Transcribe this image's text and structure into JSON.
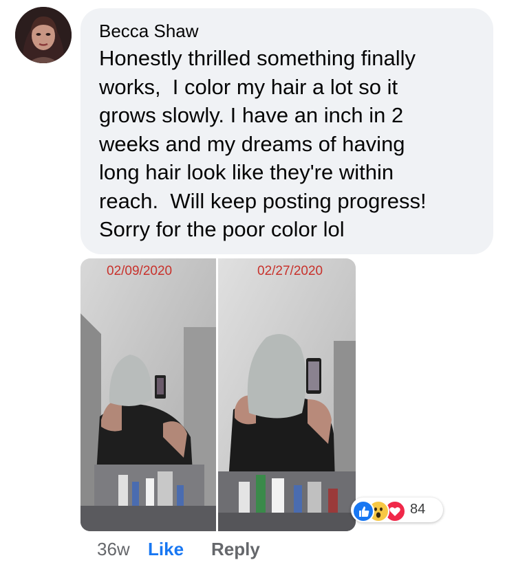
{
  "comment": {
    "author": "Becca Shaw",
    "text": "Honestly thrilled something finally works,  I color my hair a lot so it grows slowly. I have an inch in 2 weeks and my dreams of having long hair look like they're within reach.  Will keep posting progress! Sorry for the poor color lol",
    "text_lines": [
      "Honestly thrilled something finally",
      "works,  I color my hair a lot so it",
      "grows slowly. I have an inch in 2",
      "weeks and my dreams of having",
      "long hair look like they're within",
      "reach.  Will keep posting progress!",
      "Sorry for the poor color lol"
    ]
  },
  "photo": {
    "left_date": "02/09/2020",
    "right_date": "02/27/2020"
  },
  "reactions": {
    "icons": [
      "like-icon",
      "wow-icon",
      "love-icon"
    ],
    "count": "84"
  },
  "actions": {
    "time": "36w",
    "like_label": "Like",
    "reply_label": "Reply"
  },
  "colors": {
    "bubble": "#f0f2f5",
    "like_blue": "#1877f2",
    "date_red": "#c8312b",
    "secondary_text": "#65676b"
  }
}
